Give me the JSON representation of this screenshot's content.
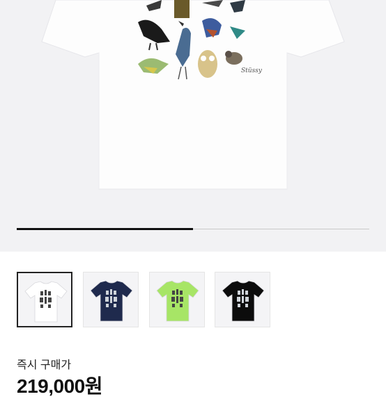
{
  "product": {
    "image_alt": "White bird graphic t-shirt",
    "shirt_colors": [
      "#ffffff",
      "#1f2a4d",
      "#a7e566",
      "#0c0c0c"
    ],
    "graphic_logo_text": "Stüssy"
  },
  "carousel": {
    "progress_fraction": 0.5
  },
  "thumbnails": [
    {
      "color_name": "white",
      "color": "#ffffff",
      "selected": true
    },
    {
      "color_name": "navy",
      "color": "#1f2a4d",
      "selected": false
    },
    {
      "color_name": "lime",
      "color": "#a7e566",
      "selected": false
    },
    {
      "color_name": "black",
      "color": "#0c0c0c",
      "selected": false
    }
  ],
  "purchase": {
    "label": "즉시 구매가",
    "price": "219,000원"
  }
}
